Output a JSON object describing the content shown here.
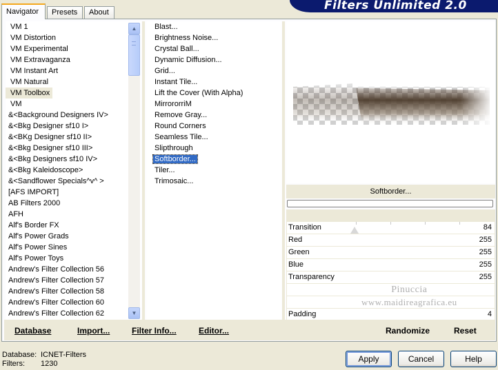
{
  "tabs": [
    {
      "label": "Navigator",
      "active": true
    },
    {
      "label": "Presets",
      "active": false
    },
    {
      "label": "About",
      "active": false
    }
  ],
  "banner": {
    "title": "Filters Unlimited 2.0"
  },
  "categories": [
    "VM 1",
    "VM Distortion",
    "VM Experimental",
    "VM Extravaganza",
    "VM Instant Art",
    "VM Natural",
    "VM Toolbox",
    "VM",
    "&<Background Designers IV>",
    "&<Bkg Designer sf10 I>",
    "&<BKg Designer sf10 II>",
    "&<Bkg Designer sf10 III>",
    "&<Bkg Designers sf10 IV>",
    "&<Bkg Kaleidoscope>",
    "&<Sandflower Specials^v^ >",
    "[AFS IMPORT]",
    "AB Filters 2000",
    "AFH",
    "Alf's Border FX",
    "Alf's Power Grads",
    "Alf's Power Sines",
    "Alf's Power Toys",
    "Andrew's Filter Collection 56",
    "Andrew's Filter Collection 57",
    "Andrew's Filter Collection 58",
    "Andrew's Filter Collection 60",
    "Andrew's Filter Collection 62"
  ],
  "selected_category": "VM Toolbox",
  "filters": [
    "Blast...",
    "Brightness Noise...",
    "Crystal Ball...",
    "Dynamic Diffusion...",
    "Grid...",
    "Instant Tile...",
    "Lift the Cover (With Alpha)",
    "MirrororriM",
    "Remove Gray...",
    "Round Corners",
    "Seamless Tile...",
    "Slipthrough",
    "Softborder...",
    "Tiler...",
    "Trimosaic..."
  ],
  "selected_filter": "Softborder...",
  "filter_name": "Softborder...",
  "progress_fraction": 0.0,
  "params": [
    {
      "name": "Transition",
      "value": "84"
    },
    {
      "name": "Red",
      "value": "255"
    },
    {
      "name": "Green",
      "value": "255"
    },
    {
      "name": "Blue",
      "value": "255"
    },
    {
      "name": "Transparency",
      "value": "255"
    }
  ],
  "padding": {
    "name": "Padding",
    "value": "4"
  },
  "watermark": {
    "line1": "Pinuccia",
    "line2": "www.maidireagrafica.eu"
  },
  "bottom_links": {
    "database": "Database",
    "import": "Import...",
    "filter_info": "Filter Info...",
    "editor": "Editor...",
    "randomize": "Randomize",
    "reset": "Reset"
  },
  "status": {
    "database_label": "Database:",
    "database_value": "ICNET-Filters",
    "filters_label": "Filters:",
    "filters_value": "1230"
  },
  "buttons": {
    "apply": "Apply",
    "cancel": "Cancel",
    "help": "Help"
  },
  "colors": {
    "selection": "#316ac5",
    "banner": "#0b1a6e",
    "dialog_bg": "#ece9d8"
  }
}
